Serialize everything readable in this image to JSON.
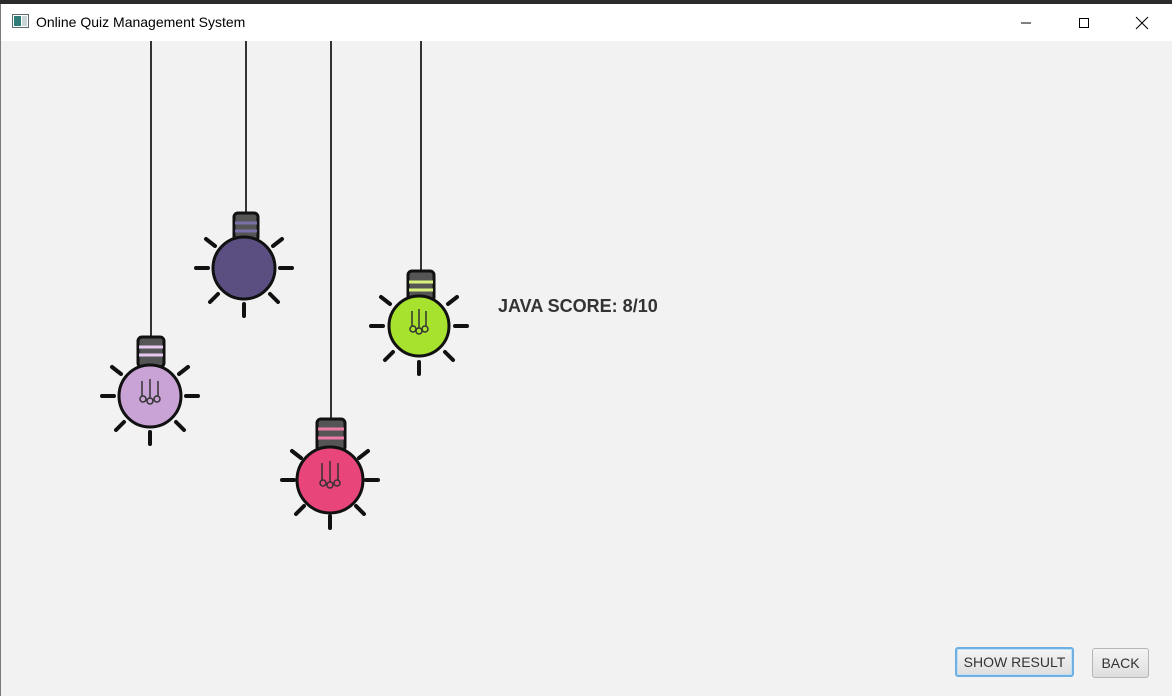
{
  "window": {
    "title": "Online Quiz Management System"
  },
  "icons": {
    "app": "app-window-icon",
    "minimize": "minimize-icon",
    "maximize": "maximize-icon",
    "close": "close-icon"
  },
  "bulb_colors": {
    "purple": "#5a4f80",
    "lilac": "#c9a3d6",
    "pink": "#e8457a",
    "green": "#a6e22e"
  },
  "result": {
    "score_text": "JAVA SCORE: 8/10"
  },
  "buttons": {
    "show_result": "SHOW RESULT",
    "back": "BACK"
  }
}
